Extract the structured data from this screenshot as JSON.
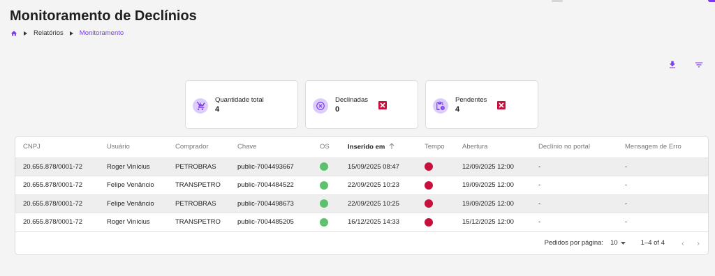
{
  "header": {
    "title": "Monitoramento de Declínios",
    "breadcrumb": {
      "home_icon": "home-icon",
      "items": [
        "Relatórios",
        "Monitoramento"
      ]
    }
  },
  "actions": {
    "download_icon": "download-icon",
    "filter_icon": "filter-icon"
  },
  "cards": [
    {
      "icon": "cart-icon",
      "label": "Quantidade total",
      "value": "4",
      "has_alert": false
    },
    {
      "icon": "cancel-circle-icon",
      "label": "Declinadas",
      "value": "0",
      "has_alert": true
    },
    {
      "icon": "clipboard-clock-icon",
      "label": "Pendentes",
      "value": "4",
      "has_alert": true
    }
  ],
  "table": {
    "columns": [
      "CNPJ",
      "Usuário",
      "Comprador",
      "Chave",
      "OS",
      "Inserido em",
      "Tempo",
      "Abertura",
      "Declínio no portal",
      "Mensagem de Erro"
    ],
    "sorted_column": "Inserido em",
    "sort_direction": "ascending",
    "rows": [
      {
        "cnpj": "20.655.878/0001-72",
        "usuario": "Roger Vinícius",
        "comprador": "PETROBRAS",
        "chave": "public-7004493667",
        "os_status": "green",
        "inserido": "15/09/2025 08:47",
        "tempo_status": "red",
        "abertura": "12/09/2025 12:00",
        "declinio": "-",
        "mensagem": "-"
      },
      {
        "cnpj": "20.655.878/0001-72",
        "usuario": "Felipe Venâncio",
        "comprador": "TRANSPETRO",
        "chave": "public-7004484522",
        "os_status": "green",
        "inserido": "22/09/2025 10:23",
        "tempo_status": "red",
        "abertura": "19/09/2025 12:00",
        "declinio": "-",
        "mensagem": "-"
      },
      {
        "cnpj": "20.655.878/0001-72",
        "usuario": "Felipe Venâncio",
        "comprador": "PETROBRAS",
        "chave": "public-7004498673",
        "os_status": "green",
        "inserido": "22/09/2025 10:25",
        "tempo_status": "red",
        "abertura": "19/09/2025 12:00",
        "declinio": "-",
        "mensagem": "-"
      },
      {
        "cnpj": "20.655.878/0001-72",
        "usuario": "Roger Vinícius",
        "comprador": "TRANSPETRO",
        "chave": "public-7004485205",
        "os_status": "green",
        "inserido": "16/12/2025 14:33",
        "tempo_status": "red",
        "abertura": "15/12/2025 12:00",
        "declinio": "-",
        "mensagem": "-"
      }
    ]
  },
  "pagination": {
    "per_page_label": "Pedidos por página:",
    "per_page_value": "10",
    "range": "1–4 of 4",
    "prev_icon": "chevron-left-icon",
    "next_icon": "chevron-right-icon"
  },
  "colors": {
    "accent": "#7c3aed",
    "icon_bg": "#dccdfb",
    "status_green": "#5ec16e",
    "status_red": "#c8103d",
    "alert_red": "#c8103d"
  }
}
